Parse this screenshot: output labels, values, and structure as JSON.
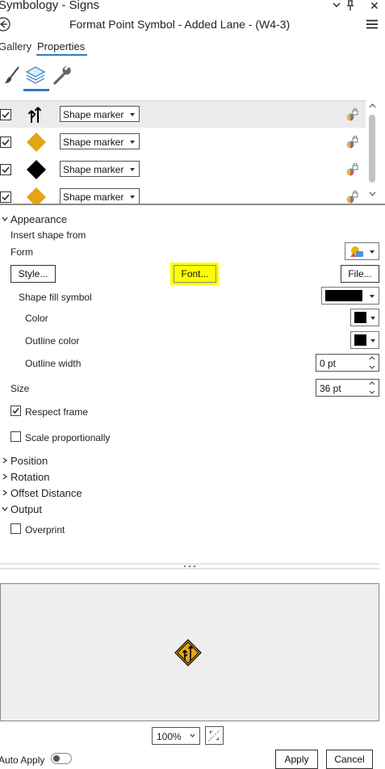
{
  "title": "Symbology - Signs",
  "subtitle": "Format Point Symbol - Added Lane - (W4-3)",
  "tabs": {
    "gallery": "Gallery",
    "properties": "Properties"
  },
  "layers": [
    {
      "checked": true,
      "symbol": "added-lane-icon",
      "type": "Shape marker",
      "selected": true
    },
    {
      "checked": true,
      "symbol": "orange-diamond-icon",
      "type": "Shape marker",
      "selected": false
    },
    {
      "checked": true,
      "symbol": "black-diamond-icon",
      "type": "Shape marker",
      "selected": false
    },
    {
      "checked": true,
      "symbol": "orange-diamond-icon",
      "type": "Shape marker",
      "selected": false
    }
  ],
  "appearance": {
    "header": "Appearance",
    "insert_shape_from": "Insert shape from",
    "form": "Form",
    "style_btn": "Style...",
    "font_btn": "Font...",
    "file_btn": "File...",
    "shape_fill_symbol": "Shape fill symbol",
    "color": "Color",
    "outline_color": "Outline color",
    "outline_width": "Outline width",
    "outline_width_value": "0 pt",
    "size": "Size",
    "size_value": "36 pt",
    "respect_frame": "Respect frame",
    "respect_frame_checked": true,
    "scale_proportionally": "Scale proportionally",
    "scale_proportionally_checked": false
  },
  "sections": {
    "position": "Position",
    "rotation": "Rotation",
    "offset_distance": "Offset Distance",
    "output": "Output"
  },
  "output": {
    "overprint": "Overprint",
    "overprint_checked": false
  },
  "zoom_value": "100%",
  "footer": {
    "auto_apply": "Auto Apply",
    "apply": "Apply",
    "cancel": "Cancel"
  },
  "colors": {
    "accent": "#2f7dc1",
    "sign_orange": "#e4a418",
    "highlight": "#ffff00"
  }
}
